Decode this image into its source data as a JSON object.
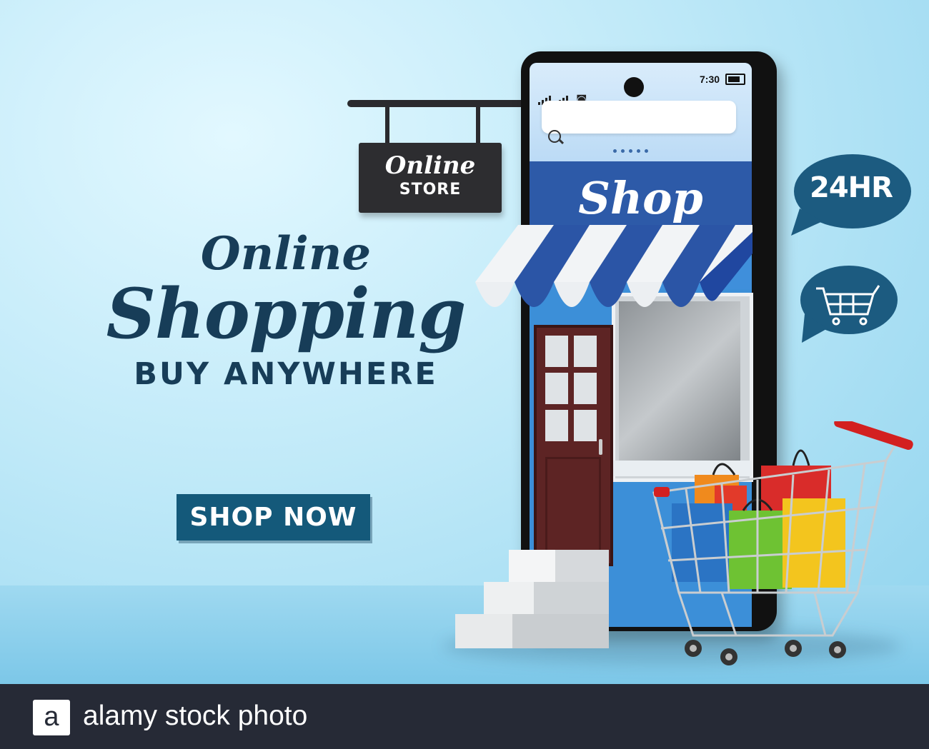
{
  "hero": {
    "line1": "Online",
    "line2": "Shopping",
    "line3": "BUY ANYWHERE",
    "button_label": "SHOP NOW"
  },
  "sign": {
    "line1": "Online",
    "line2": "STORE"
  },
  "phone": {
    "status_time": "7:30",
    "shop_title": "Shop"
  },
  "bubbles": {
    "hours": "24HR"
  },
  "footer": {
    "logo_letter": "a",
    "text": "alamy stock photo"
  },
  "colors": {
    "brand_dark": "#173d58",
    "button": "#14597a",
    "shop_band": "#2d5aa8",
    "bubble": "#1c5b80",
    "footer": "#262a36"
  }
}
